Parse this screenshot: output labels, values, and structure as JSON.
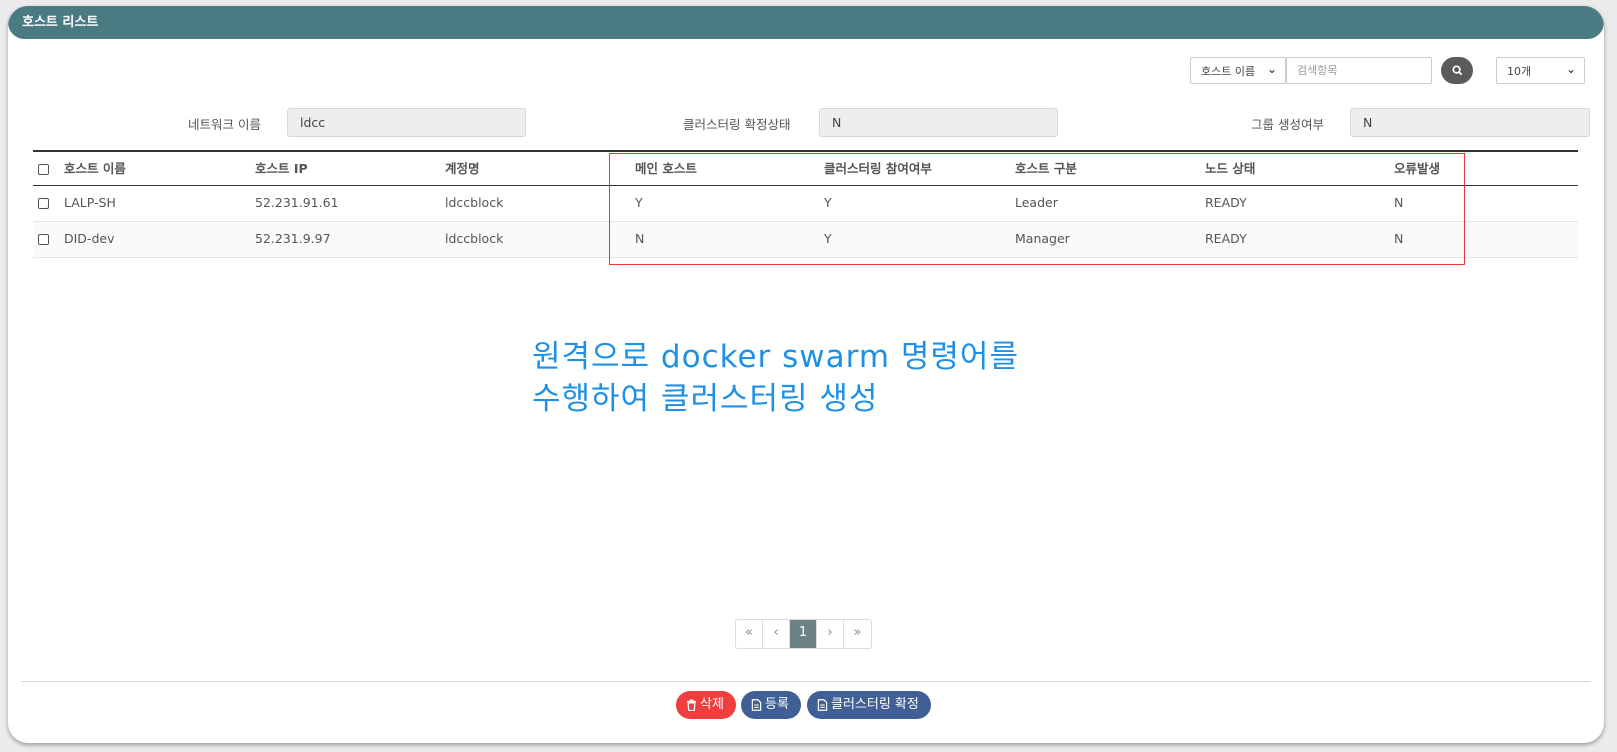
{
  "header": {
    "title": "호스트 리스트"
  },
  "search": {
    "field_select": "호스트 이름",
    "placeholder": "검색항목",
    "page_size": "10개"
  },
  "info": {
    "network_label": "네트워크 이름",
    "network_value": "ldcc",
    "cluster_confirm_label": "클러스터링 확정상태",
    "cluster_confirm_value": "N",
    "group_created_label": "그룹 생성여부",
    "group_created_value": "N"
  },
  "table": {
    "columns": [
      "호스트 이름",
      "호스트 IP",
      "계정명",
      "메인 호스트",
      "클러스터링 참여여부",
      "호스트 구분",
      "노드 상태",
      "오류발생"
    ],
    "rows": [
      [
        "LALP-SH",
        "52.231.91.61",
        "ldccblock",
        "Y",
        "Y",
        "Leader",
        "READY",
        "N"
      ],
      [
        "DID-dev",
        "52.231.9.97",
        "ldccblock",
        "N",
        "Y",
        "Manager",
        "READY",
        "N"
      ]
    ]
  },
  "annotation": {
    "line1": "원격으로 docker swarm 명령어를",
    "line2": "수행하여 클러스터링 생성"
  },
  "pagination": {
    "first": "«",
    "prev": "‹",
    "current": "1",
    "next": "›",
    "last": "»"
  },
  "actions": {
    "delete": "삭제",
    "register": "등록",
    "confirm_cluster": "클러스터링 확정"
  },
  "colors": {
    "header": "#4a7b83",
    "delete": "#f03e3e",
    "action": "#3f5f96",
    "annotation": "#1e90e6",
    "highlight": "#e53935"
  }
}
